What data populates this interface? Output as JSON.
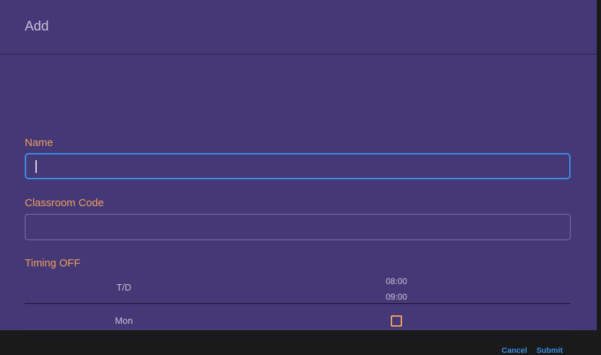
{
  "dialog": {
    "title": "Add"
  },
  "form": {
    "name_label": "Name",
    "name_value": "",
    "classroom_label": "Classroom Code",
    "classroom_value": "",
    "timing_label": "Timing OFF"
  },
  "timing": {
    "header_label": "T/D",
    "slot": {
      "start": "08:00",
      "end": "09:00"
    },
    "days": [
      {
        "label": "Mon",
        "checked": false
      }
    ]
  },
  "actions": {
    "cancel_label": "Cancel",
    "submit_label": "Submit"
  },
  "colors": {
    "background": "#453877",
    "label": "#f0a05c",
    "accent": "#3a8ee6"
  }
}
